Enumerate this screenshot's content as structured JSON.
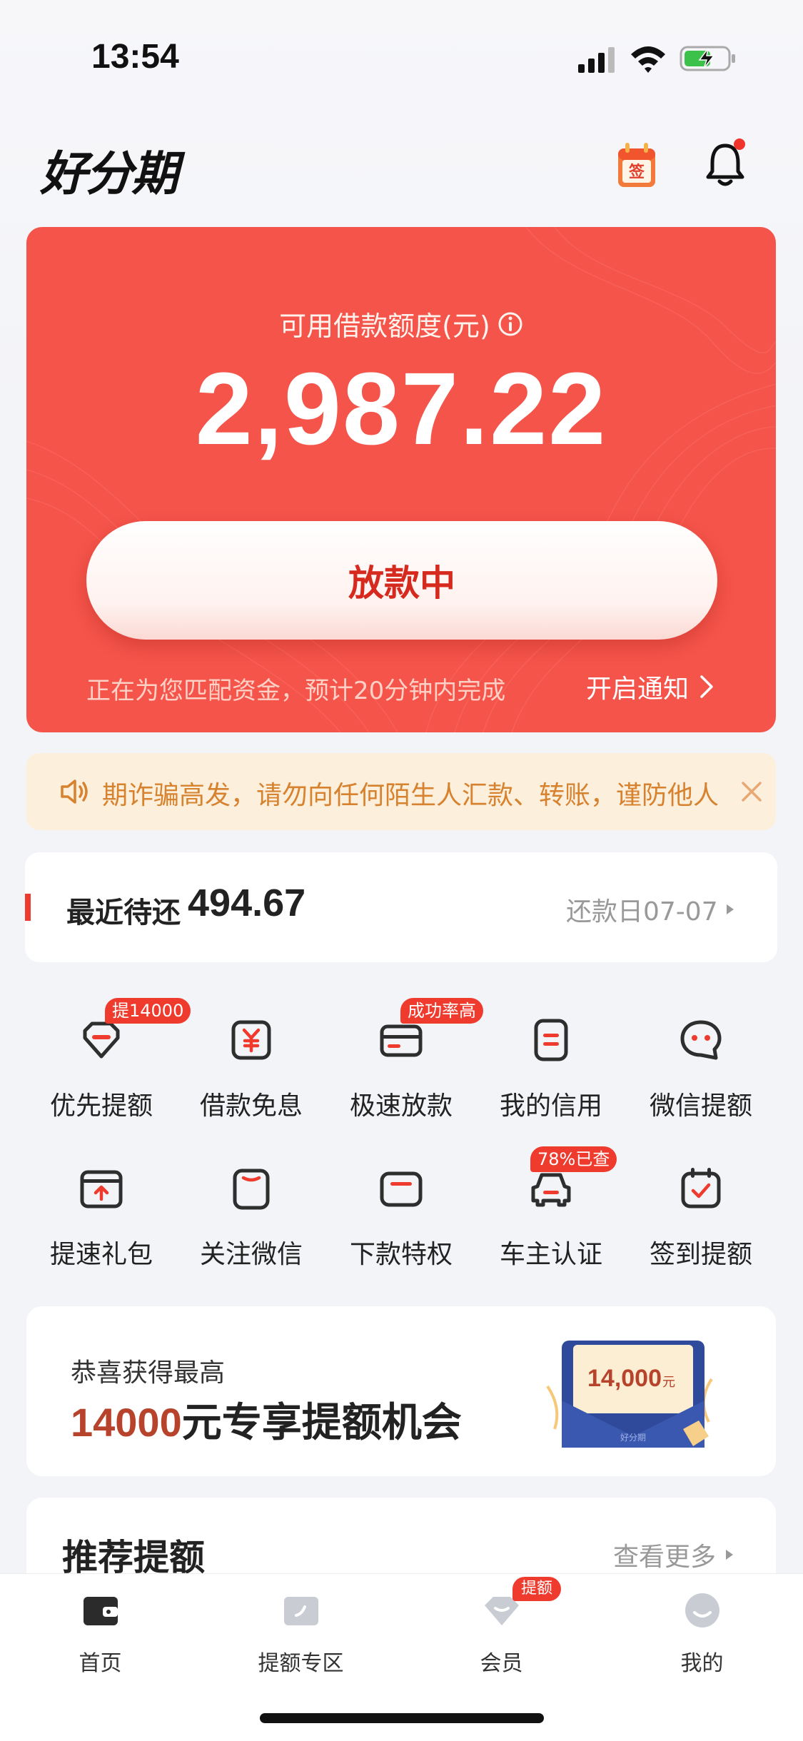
{
  "status_bar": {
    "time": "13:54"
  },
  "header": {
    "logo": "好分期",
    "signin_label": "签"
  },
  "credit": {
    "label": "可用借款额度(元)",
    "amount": "2,987.22",
    "button_label": "放款中",
    "status_text": "正在为您匹配资金，预计20分钟内完成",
    "notify_label": "开启通知"
  },
  "notice": {
    "text": "期诈骗高发，请勿向任何陌生人汇款、转账，谨防他人"
  },
  "repay": {
    "label": "最近待还",
    "amount": "494.67",
    "due_date": "还款日07-07"
  },
  "features": [
    {
      "label": "优先提额",
      "badge": "提14000",
      "icon": "tag-icon"
    },
    {
      "label": "借款免息",
      "badge": "",
      "icon": "yuan-icon"
    },
    {
      "label": "极速放款",
      "badge": "成功率高",
      "icon": "card-icon"
    },
    {
      "label": "我的信用",
      "badge": "",
      "icon": "document-icon"
    },
    {
      "label": "微信提额",
      "badge": "",
      "icon": "chat-icon"
    },
    {
      "label": "提速礼包",
      "badge": "",
      "icon": "gift-box-icon"
    },
    {
      "label": "关注微信",
      "badge": "",
      "icon": "smile-box-icon"
    },
    {
      "label": "下款特权",
      "badge": "",
      "icon": "window-icon"
    },
    {
      "label": "车主认证",
      "badge": "78%已查",
      "icon": "car-icon"
    },
    {
      "label": "签到提额",
      "badge": "",
      "icon": "calendar-check-icon"
    }
  ],
  "promo": {
    "subtitle": "恭喜获得最高",
    "amount": "14000",
    "title_suffix": "元专享提额机会",
    "envelope_amount": "14,000",
    "envelope_unit": "元",
    "envelope_brand": "好分期"
  },
  "recommend": {
    "title": "推荐提额",
    "more_label": "查看更多"
  },
  "bottom_nav": [
    {
      "label": "首页",
      "badge": "",
      "icon": "wallet-icon",
      "active": true
    },
    {
      "label": "提额专区",
      "badge": "",
      "icon": "card-swipe-icon",
      "active": false
    },
    {
      "label": "会员",
      "badge": "提额",
      "icon": "diamond-icon",
      "active": false
    },
    {
      "label": "我的",
      "badge": "",
      "icon": "profile-icon",
      "active": false
    }
  ],
  "colors": {
    "brand_red": "#f4544a",
    "accent_red": "#ef3b2e",
    "notice_text": "#d7822e"
  }
}
